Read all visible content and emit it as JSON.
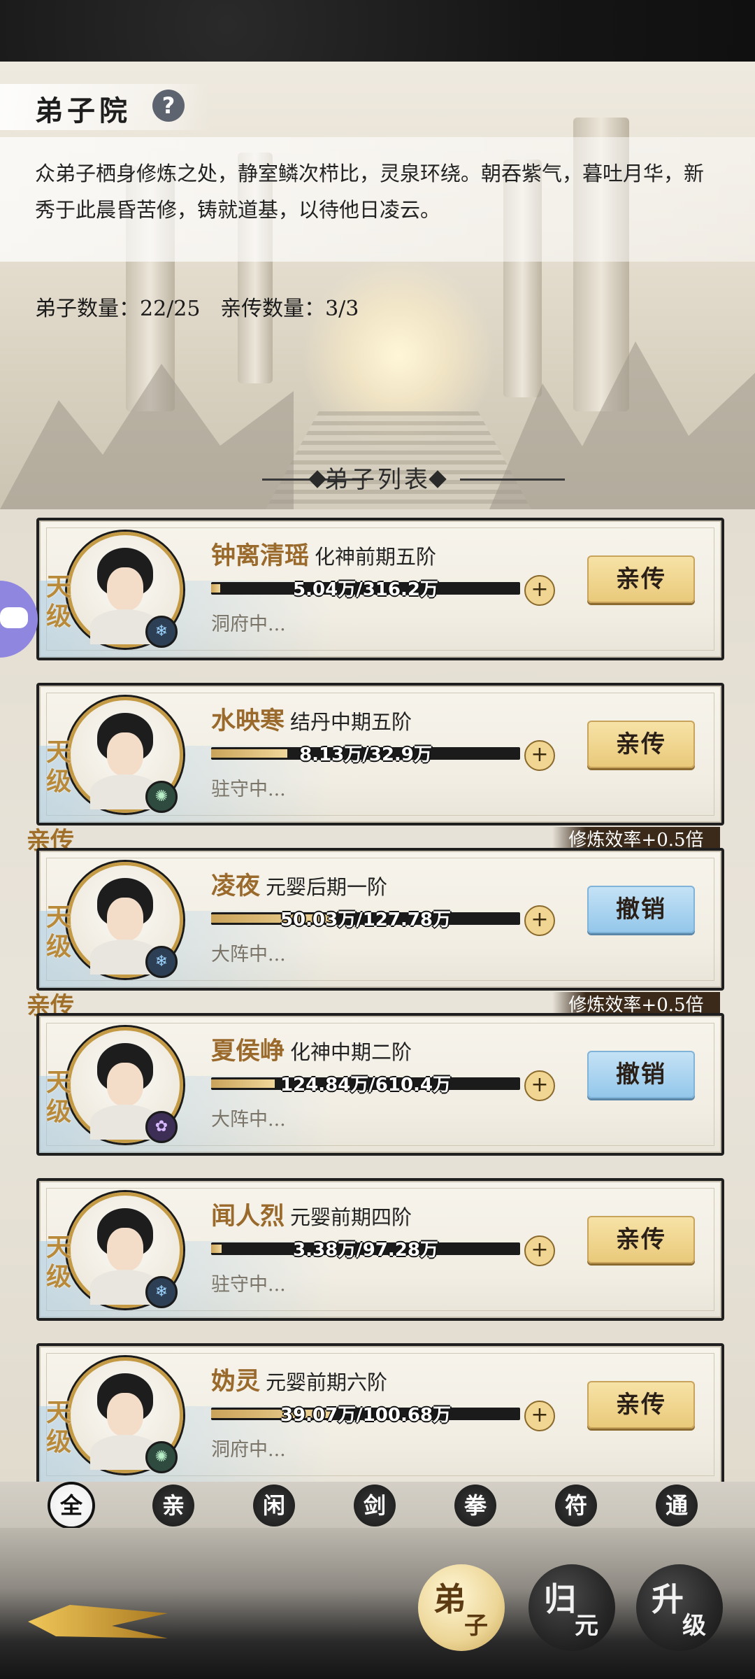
{
  "header": {
    "title": "弟子院",
    "help_icon": "?",
    "description": "众弟子栖身修炼之处，静室鳞次栉比，灵泉环绕。朝吞紫气，暮吐月华，新秀于此晨昏苦修，铸就道基，以待他日凌云。",
    "stats": "弟子数量：22/25   亲传数量：3/3"
  },
  "list_title": "弟子列表",
  "disciples": [
    {
      "grade": "天级",
      "name": "钟离清瑶",
      "realm": "化神前期五阶",
      "progress_text": "5.04万/316.2万",
      "progress": 0.016,
      "status": "洞府中...",
      "action": "亲传",
      "action_style": "gold",
      "element": "frost",
      "element_icon": "❄",
      "is_direct": false,
      "direct_label": "",
      "bonus": ""
    },
    {
      "grade": "天级",
      "name": "水映寒",
      "realm": "结丹中期五阶",
      "progress_text": "8.13万/32.9万",
      "progress": 0.247,
      "status": "驻守中...",
      "action": "亲传",
      "action_style": "gold",
      "element": "wind",
      "element_icon": "✺",
      "is_direct": false,
      "direct_label": "",
      "bonus": ""
    },
    {
      "grade": "天级",
      "name": "凌夜",
      "realm": "元婴后期一阶",
      "progress_text": "50.03万/127.78万",
      "progress": 0.392,
      "status": "大阵中...",
      "action": "撤销",
      "action_style": "blue",
      "element": "frost",
      "element_icon": "❄",
      "is_direct": true,
      "direct_label": "亲传",
      "bonus": "修炼效率+0.5倍"
    },
    {
      "grade": "天级",
      "name": "夏侯峥",
      "realm": "化神中期二阶",
      "progress_text": "124.84万/610.4万",
      "progress": 0.205,
      "status": "大阵中...",
      "action": "撤销",
      "action_style": "blue",
      "element": "flame",
      "element_icon": "✿",
      "is_direct": true,
      "direct_label": "亲传",
      "bonus": "修炼效率+0.5倍"
    },
    {
      "grade": "天级",
      "name": "闻人烈",
      "realm": "元婴前期四阶",
      "progress_text": "3.38万/97.28万",
      "progress": 0.035,
      "status": "驻守中...",
      "action": "亲传",
      "action_style": "gold",
      "element": "frost",
      "element_icon": "❄",
      "is_direct": false,
      "direct_label": "",
      "bonus": ""
    },
    {
      "grade": "天级",
      "name": "妫灵",
      "realm": "元婴前期六阶",
      "progress_text": "39.07万/100.68万",
      "progress": 0.388,
      "status": "洞府中...",
      "action": "亲传",
      "action_style": "gold",
      "element": "wind",
      "element_icon": "✺",
      "is_direct": false,
      "direct_label": "",
      "bonus": ""
    }
  ],
  "filters": [
    "全",
    "亲",
    "闲",
    "剑",
    "拳",
    "符",
    "通"
  ],
  "active_filter": 0,
  "bottom_nav": [
    {
      "top": "弟",
      "bottom": "子",
      "active": true
    },
    {
      "top": "归",
      "bottom": "元",
      "active": false
    },
    {
      "top": "升",
      "bottom": "级",
      "active": false
    }
  ],
  "colors": {
    "accent_gold": "#c59a45",
    "name_brown": "#9a6a2c",
    "revoke_blue": "#92c6ea"
  }
}
